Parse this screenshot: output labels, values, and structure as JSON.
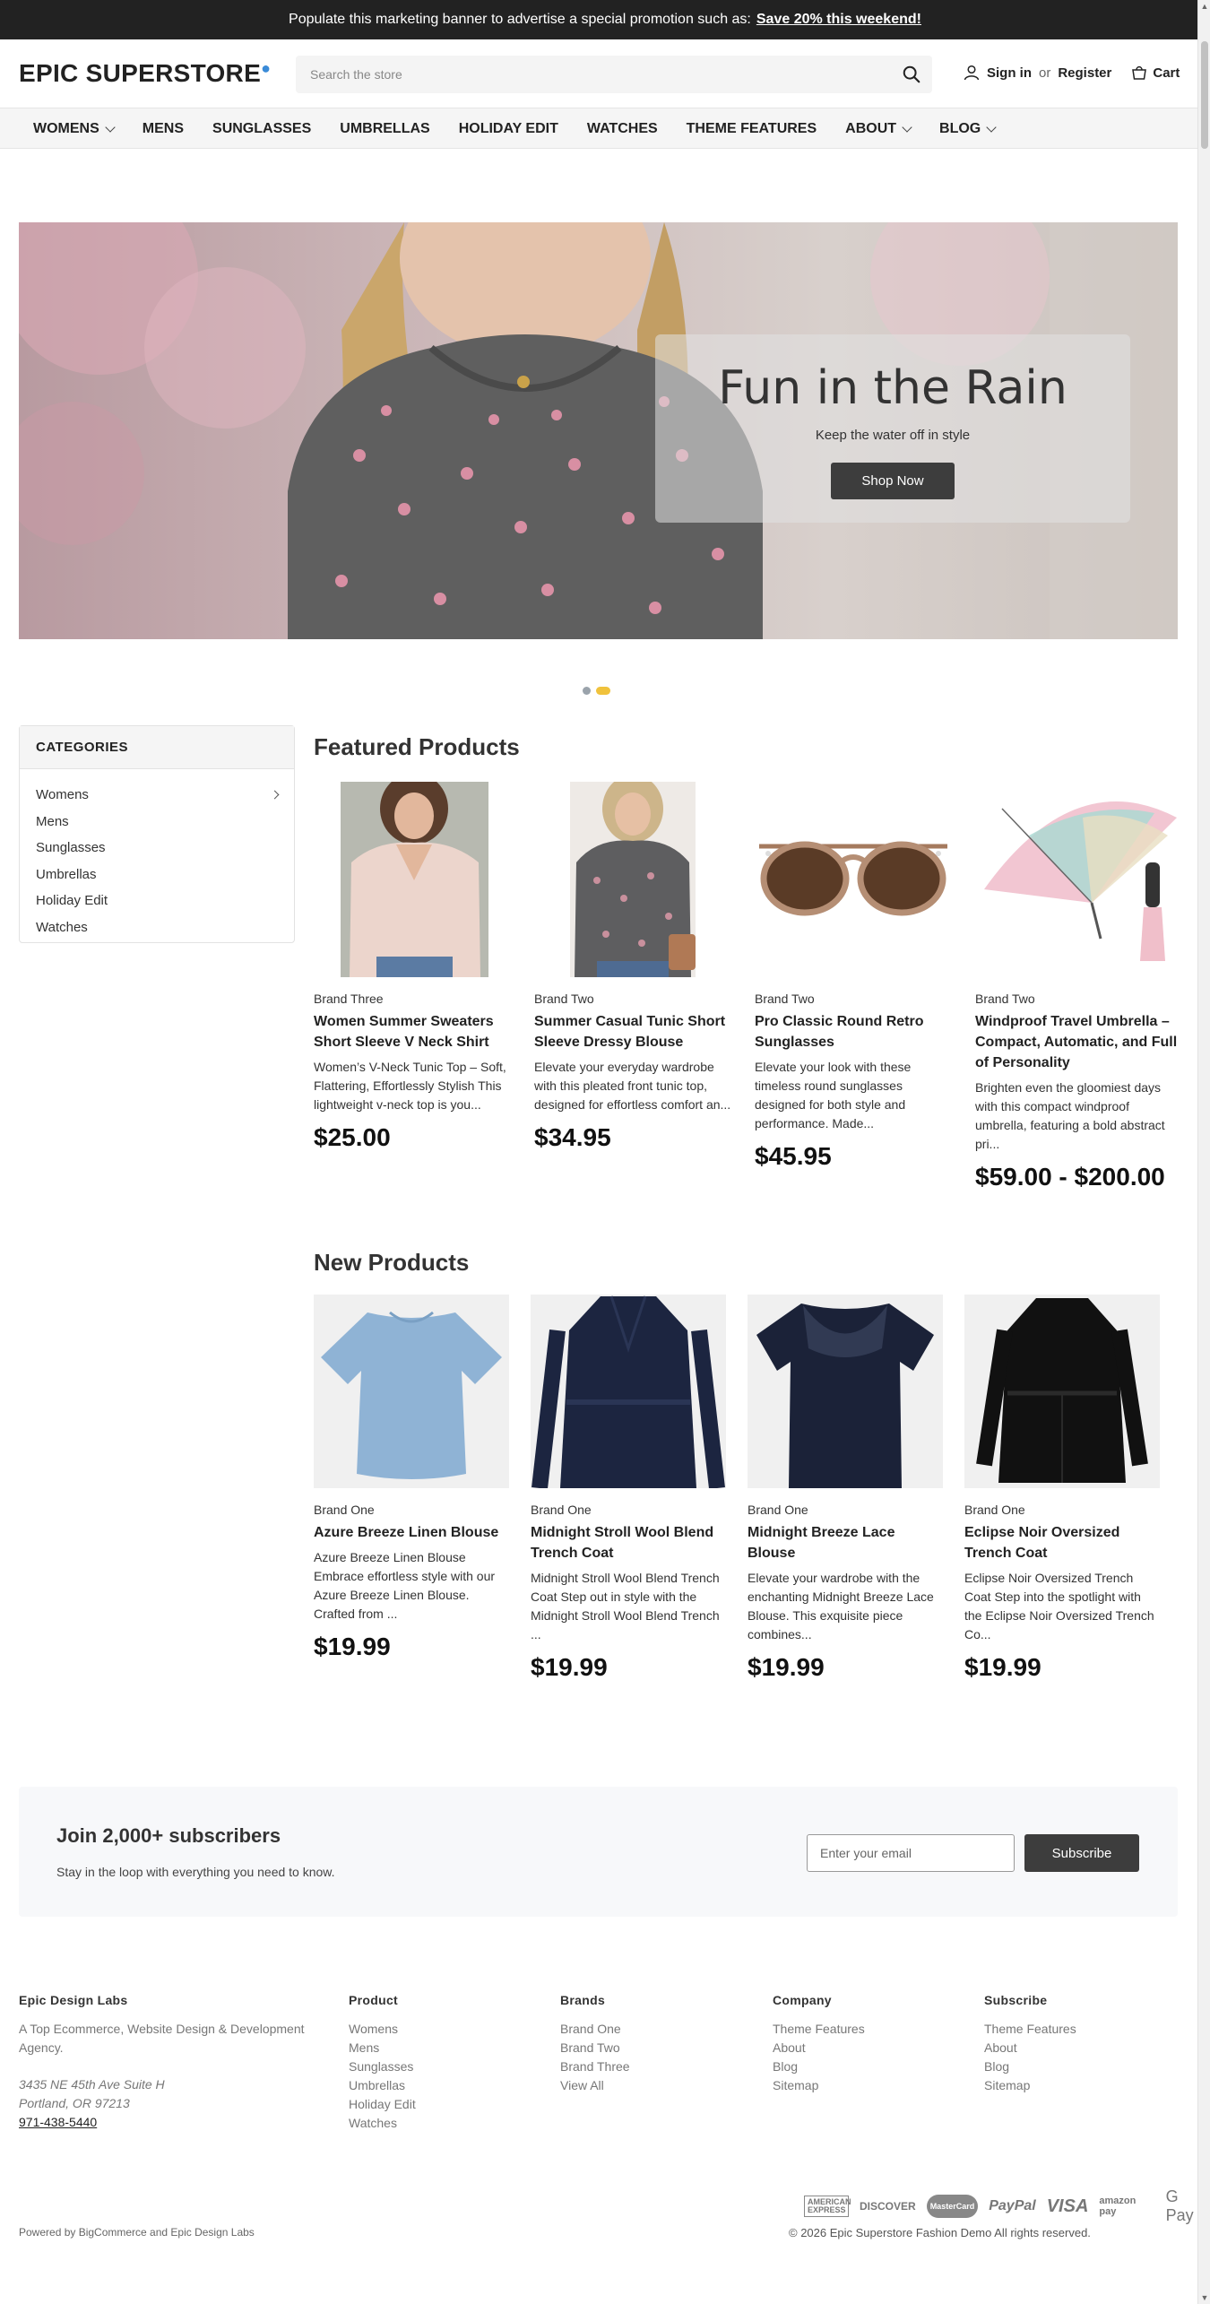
{
  "promo": {
    "text": "Populate this marketing banner to advertise a special promotion such as:",
    "link": "Save 20% this weekend!"
  },
  "header": {
    "logo": "EPIC SUPERSTORE",
    "search_placeholder": "Search the store",
    "sign_in": "Sign in",
    "or": "or",
    "register": "Register",
    "cart": "Cart"
  },
  "nav": [
    "WOMENS",
    "MENS",
    "SUNGLASSES",
    "UMBRELLAS",
    "HOLIDAY EDIT",
    "WATCHES",
    "THEME FEATURES",
    "ABOUT",
    "BLOG"
  ],
  "hero": {
    "title": "Fun in the Rain",
    "subtitle": "Keep the water off in style",
    "button": "Shop Now"
  },
  "categories": {
    "title": "CATEGORIES",
    "items": [
      "Womens",
      "Mens",
      "Sunglasses",
      "Umbrellas",
      "Holiday Edit",
      "Watches"
    ]
  },
  "featured": {
    "title": "Featured Products",
    "products": [
      {
        "brand": "Brand Three",
        "name": "Women Summer Sweaters Short Sleeve V Neck Shirt",
        "desc": "Women’s V-Neck Tunic Top – Soft, Flattering, Effortlessly Stylish This lightweight v-neck top is you...",
        "price": "$25.00"
      },
      {
        "brand": "Brand Two",
        "name": "Summer Casual Tunic Short Sleeve Dressy Blouse",
        "desc": "Elevate your everyday wardrobe with this pleated front tunic top, designed for effortless comfort an...",
        "price": "$34.95"
      },
      {
        "brand": "Brand Two",
        "name": "Pro Classic Round Retro Sunglasses",
        "desc": "Elevate your look with these timeless round sunglasses designed for both style and performance. Made...",
        "price": "$45.95"
      },
      {
        "brand": "Brand Two",
        "name": "Windproof Travel Umbrella – Compact, Automatic, and Full of Personality",
        "desc": "Brighten even the gloomiest days with this compact windproof umbrella, featuring a bold abstract pri...",
        "price": "$59.00 - $200.00"
      }
    ]
  },
  "new_products": {
    "title": "New Products",
    "products": [
      {
        "brand": "Brand One",
        "name": "Azure Breeze Linen Blouse",
        "desc": "Azure Breeze Linen Blouse Embrace effortless style with our Azure Breeze Linen Blouse. Crafted from ...",
        "price": "$19.99"
      },
      {
        "brand": "Brand One",
        "name": "Midnight Stroll Wool Blend Trench Coat",
        "desc": "Midnight Stroll Wool Blend Trench Coat Step out in style with the Midnight Stroll Wool Blend Trench ...",
        "price": "$19.99"
      },
      {
        "brand": "Brand One",
        "name": "Midnight Breeze Lace Blouse",
        "desc": "Elevate your wardrobe with the enchanting Midnight Breeze Lace Blouse. This exquisite piece combines...",
        "price": "$19.99"
      },
      {
        "brand": "Brand One",
        "name": "Eclipse Noir Oversized Trench Coat",
        "desc": "Eclipse Noir Oversized Trench Coat Step into the spotlight with the Eclipse Noir Oversized Trench Co...",
        "price": "$19.99"
      }
    ]
  },
  "newsletter": {
    "title": "Join 2,000+ subscribers",
    "subtitle": "Stay in the loop with everything you need to know.",
    "placeholder": "Enter your email",
    "button": "Subscribe"
  },
  "footer": {
    "company_name": "Epic Design Labs",
    "company_desc": "A Top Ecommerce, Website Design & Development Agency.",
    "address1": "3435 NE 45th Ave Suite H",
    "address2": "Portland, OR 97213",
    "phone": "971-438-5440",
    "product": {
      "title": "Product",
      "links": [
        "Womens",
        "Mens",
        "Sunglasses",
        "Umbrellas",
        "Holiday Edit",
        "Watches"
      ]
    },
    "brands": {
      "title": "Brands",
      "links": [
        "Brand One",
        "Brand Two",
        "Brand Three",
        "View All"
      ]
    },
    "company": {
      "title": "Company",
      "links": [
        "Theme Features",
        "About",
        "Blog",
        "Sitemap"
      ]
    },
    "subscribe": {
      "title": "Subscribe",
      "links": [
        "Theme Features",
        "About",
        "Blog",
        "Sitemap"
      ]
    },
    "payments": [
      "AMERICAN EXPRESS",
      "DISCOVER",
      "MasterCard",
      "PayPal",
      "VISA",
      "amazon pay",
      "G Pay"
    ],
    "powered": "Powered by BigCommerce and Epic Design Labs",
    "copyright": "© 2026 Epic Superstore Fashion Demo All rights reserved."
  },
  "colors": {
    "brand_dot": "#3a8bd8",
    "slider_active": "#f0c23c",
    "button_dark": "#3d3d3d"
  }
}
